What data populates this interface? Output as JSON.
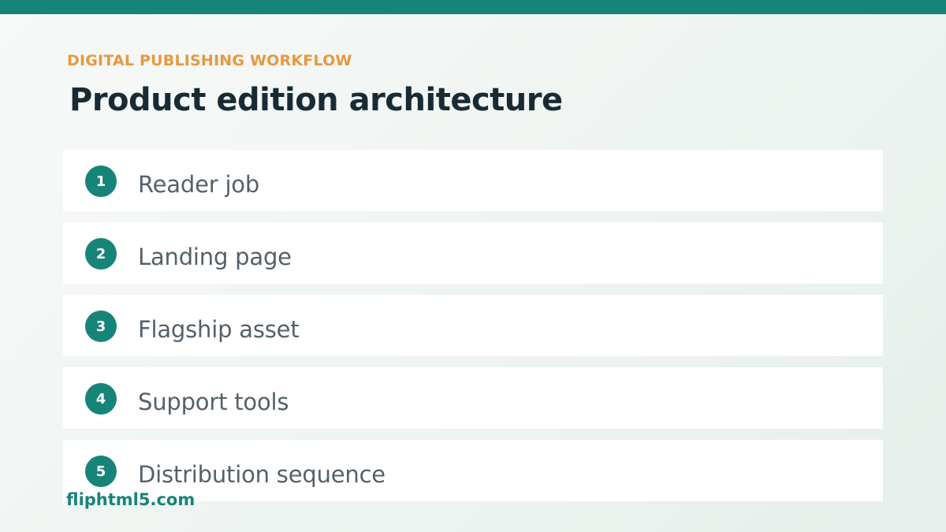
{
  "header": {
    "eyebrow": "DIGITAL PUBLISHING WORKFLOW",
    "title": "Product edition architecture"
  },
  "steps": [
    {
      "number": "1",
      "label": "Reader job"
    },
    {
      "number": "2",
      "label": "Landing page"
    },
    {
      "number": "3",
      "label": "Flagship asset"
    },
    {
      "number": "4",
      "label": "Support tools"
    },
    {
      "number": "5",
      "label": "Distribution sequence"
    }
  ],
  "watermark": "fliphtml5.com",
  "colors": {
    "accent": "#178479",
    "eyebrow": "#e7983f",
    "title": "#182b35",
    "step_text": "#546169"
  }
}
